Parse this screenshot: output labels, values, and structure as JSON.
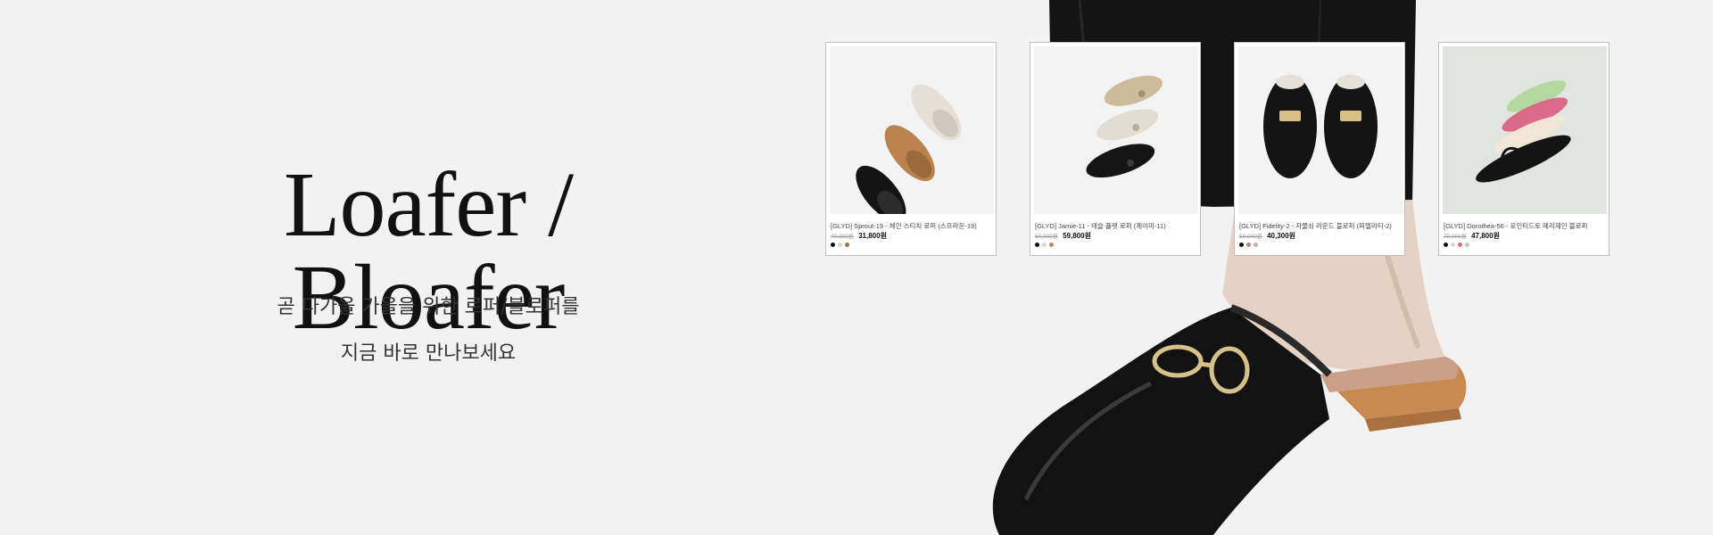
{
  "hero": {
    "title": "Loafer / Bloafer",
    "subtitle_line1": "곧 다가올 가을을 위한 로퍼/블로퍼를",
    "subtitle_line2": "지금 바로 만나보세요"
  },
  "products": [
    {
      "name": "[GLYD] Sprout-19 - 체인 스티치 로퍼 (스프라운-19)",
      "original_price": "40,000원",
      "sale_price": "31,800원",
      "swatches": [
        "#111111",
        "#d9d4cc",
        "#a8703a"
      ]
    },
    {
      "name": "[GLYD] Jamie-11 - 태슬 플랫 로퍼 (제이미-11)",
      "original_price": "80,000원",
      "sale_price": "59,800원",
      "swatches": [
        "#111111",
        "#d9d4cc",
        "#b08a60"
      ]
    },
    {
      "name": "[GLYD] Fidelity-2 - 자물쇠 라운드 블로퍼 (피델리티-2)",
      "original_price": "50,000원",
      "sale_price": "40,300원",
      "swatches": [
        "#111111",
        "#b08a60",
        "#d9a8a0"
      ]
    },
    {
      "name": "[GLYD] Dorothea-56 - 포인티드토 메리제인 블로퍼",
      "original_price": "70,000원",
      "sale_price": "47,800원",
      "swatches": [
        "#111111",
        "#e8d8c8",
        "#d96a8a",
        "#b4d8a0"
      ]
    }
  ]
}
